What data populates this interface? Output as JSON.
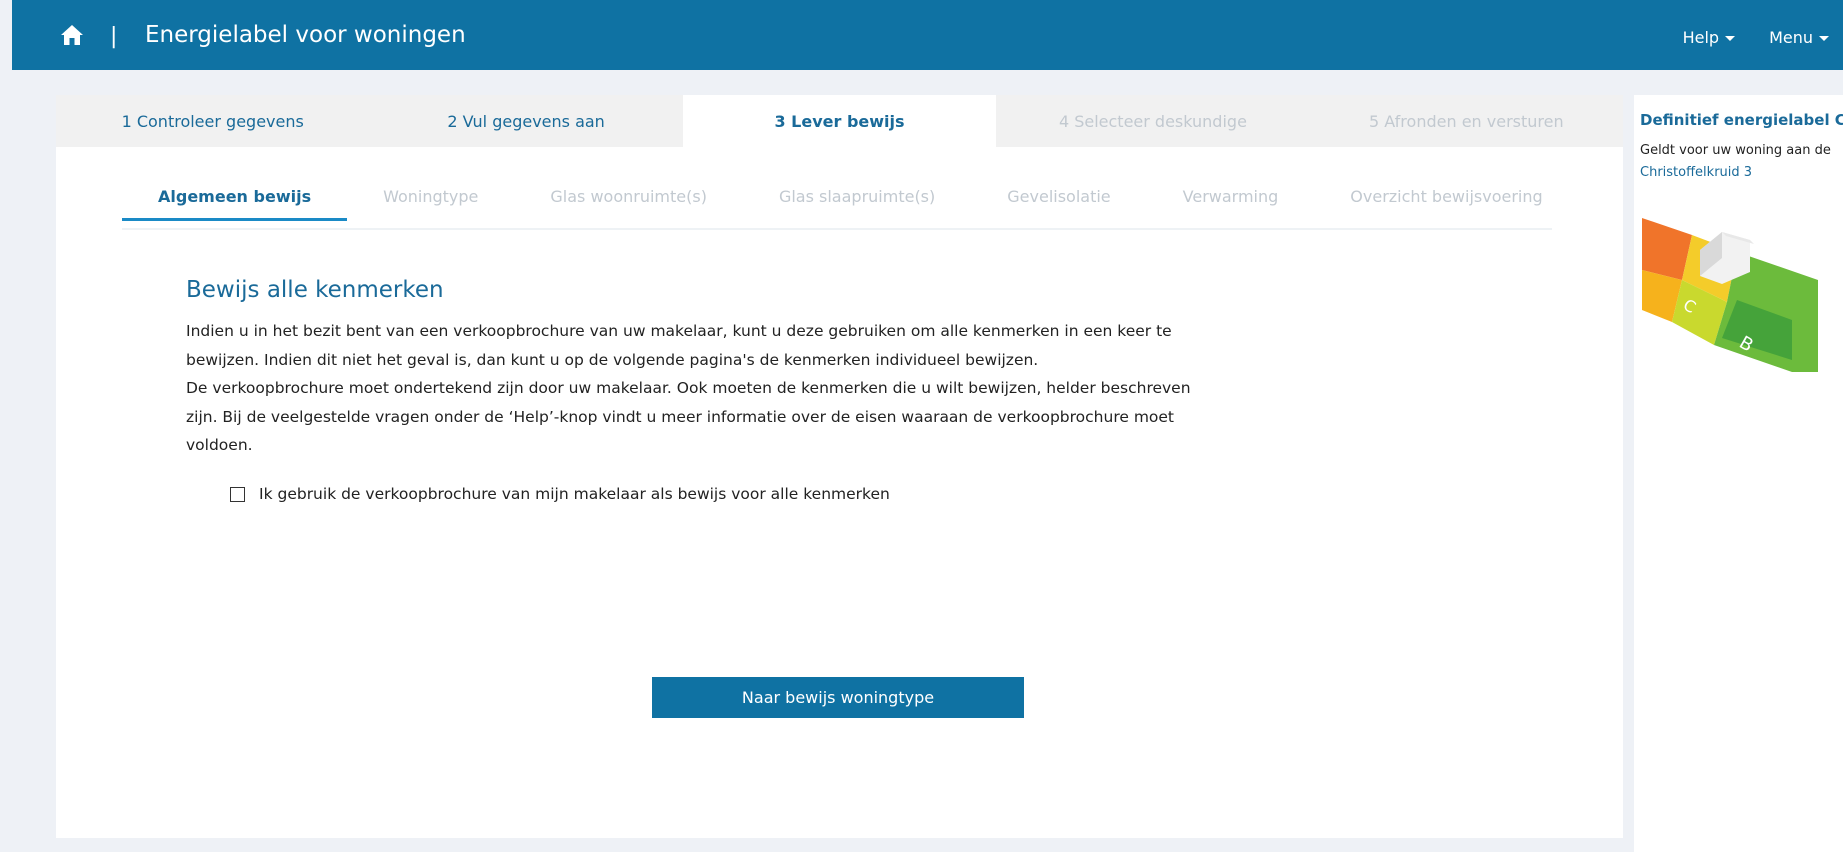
{
  "header": {
    "title": "Energielabel voor woningen",
    "divider": "|",
    "nav": [
      {
        "label": "Help"
      },
      {
        "label": "Menu"
      }
    ]
  },
  "steps": [
    {
      "label": "1 Controleer gegevens",
      "state": "done"
    },
    {
      "label": "2 Vul gegevens aan",
      "state": "done"
    },
    {
      "label": "3 Lever bewijs",
      "state": "active"
    },
    {
      "label": "4 Selecteer deskundige",
      "state": "disabled"
    },
    {
      "label": "5 Afronden en versturen",
      "state": "disabled"
    }
  ],
  "subtabs": [
    {
      "label": "Algemeen bewijs",
      "state": "active"
    },
    {
      "label": "Woningtype",
      "state": "disabled"
    },
    {
      "label": "Glas woonruimte(s)",
      "state": "disabled"
    },
    {
      "label": "Glas slaapruimte(s)",
      "state": "disabled"
    },
    {
      "label": "Gevelisolatie",
      "state": "disabled"
    },
    {
      "label": "Verwarming",
      "state": "disabled"
    },
    {
      "label": "Overzicht bewijsvoering",
      "state": "disabled"
    }
  ],
  "main": {
    "heading": "Bewijs alle kenmerken",
    "paragraphs": [
      "Indien u in het bezit bent van een verkoopbrochure van uw makelaar, kunt u deze gebruiken om alle kenmerken in een keer te",
      "bewijzen. Indien dit niet het geval is, dan kunt u op de volgende pagina's de kenmerken individueel bewijzen.",
      "De verkoopbrochure moet ondertekend zijn door uw makelaar. Ook moeten de kenmerken die u wilt bewijzen, helder beschreven",
      "zijn. Bij de veelgestelde vragen onder de ‘Help’-knop vindt u meer informatie over de eisen waaraan de verkoopbrochure moet",
      "voldoen."
    ],
    "checkbox_label": "Ik gebruik de verkoopbrochure van mijn makelaar als bewijs voor alle kenmerken",
    "checkbox_checked": false,
    "button_label": "Naar bewijs woningtype"
  },
  "sidebar": {
    "title": "Definitief energielabel C",
    "text": "Geldt voor uw woning aan de",
    "address": "Christoffelkruid 3",
    "label_letters": [
      "C",
      "B"
    ]
  },
  "colors": {
    "brand": "#0f72a3",
    "link": "#1a6a99",
    "disabled": "#c2c9d0"
  },
  "icons": {
    "home": "home-icon",
    "caret": "caret-down-icon"
  }
}
